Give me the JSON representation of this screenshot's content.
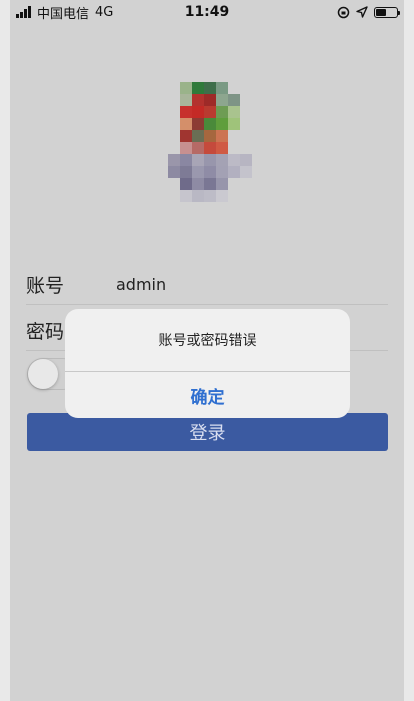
{
  "status_bar": {
    "carrier": "中国电信",
    "network": "4G",
    "time": "11:49",
    "icons": [
      "signal-icon",
      "rotation-lock-icon",
      "location-arrow-icon",
      "battery-icon"
    ]
  },
  "form": {
    "account_label": "账号",
    "account_value": "admin",
    "password_label": "密码",
    "login_button": "登录"
  },
  "alert": {
    "message": "账号或密码错误",
    "confirm_button": "确定"
  },
  "colors": {
    "primary": "#3b5aa1",
    "alert_button": "#2f6fd0",
    "overlay_background": "#d2d2d2"
  }
}
